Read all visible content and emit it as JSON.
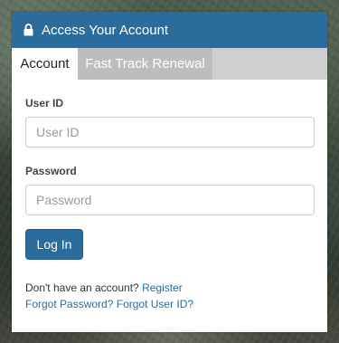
{
  "panel": {
    "title": "Access Your Account",
    "header_icon": "lock-icon",
    "colors": {
      "accent": "#2a6c9b",
      "tab_inactive": "#bdbdbd"
    }
  },
  "tabs": [
    {
      "label": "Account",
      "active": true
    },
    {
      "label": "Fast Track Renewal",
      "active": false
    }
  ],
  "form": {
    "user_id": {
      "label": "User ID",
      "placeholder": "User ID",
      "value": ""
    },
    "password": {
      "label": "Password",
      "placeholder": "Password",
      "value": ""
    },
    "login_label": "Log In"
  },
  "footer": {
    "no_account_text": "Don't have an account?",
    "register_link": "Register",
    "forgot_password_link": "Forgot Password?",
    "forgot_userid_link": "Forgot User ID?"
  }
}
